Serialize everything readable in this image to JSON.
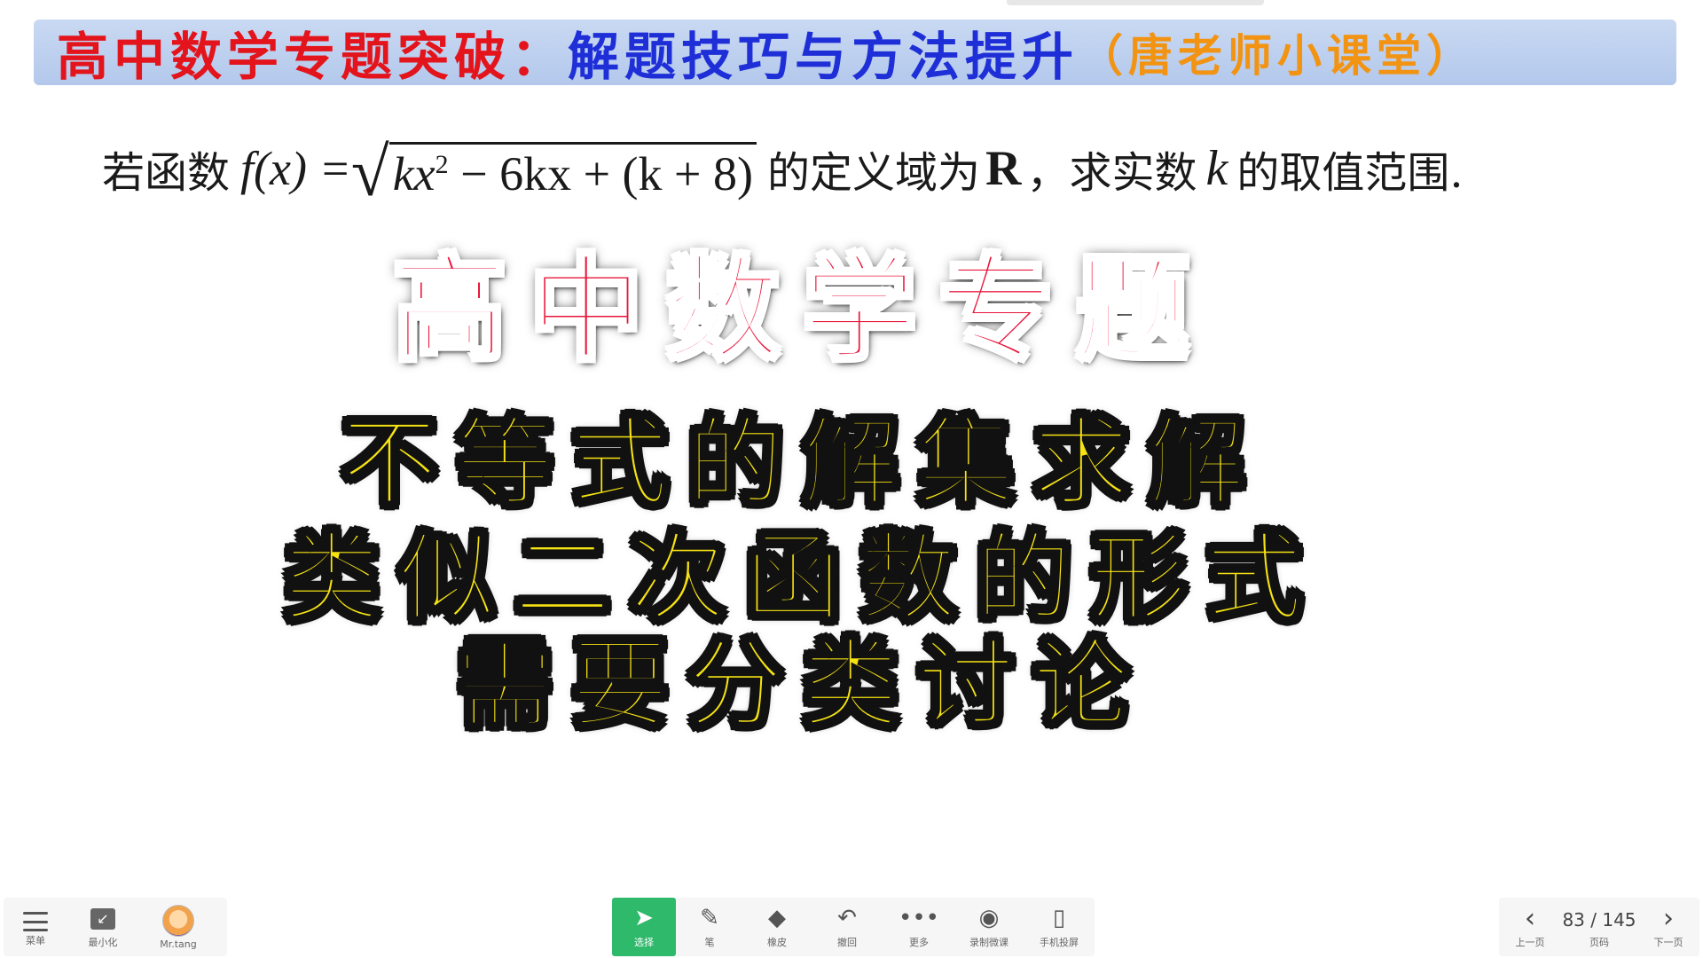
{
  "header": {
    "title_red": "高中数学专题突破：",
    "title_blue": "解题技巧与方法提升",
    "title_orange": "（唐老师小课堂）"
  },
  "problem": {
    "prefix": "若函数",
    "fx": "f(x) =",
    "radicand_a": "kx",
    "radicand_exp": "2",
    "radicand_b": " − 6kx + (k + 8)",
    "mid": "的定义域为",
    "set_r": "R",
    "mid2": "，求实数",
    "var_k": "k",
    "suffix": "的取值范围."
  },
  "overlay": {
    "title": "高中数学专题",
    "line1": "不等式的解集求解",
    "line2": "类似二次函数的形式",
    "line3": "需要分类讨论"
  },
  "toolbar": {
    "left": [
      {
        "name": "menu",
        "label": "菜单",
        "icon": "menu-icon"
      },
      {
        "name": "minimize",
        "label": "最小化",
        "icon": "minimize-icon"
      },
      {
        "name": "user",
        "label": "Mr.tang",
        "icon": "avatar-icon"
      }
    ],
    "center": [
      {
        "name": "select",
        "label": "选择",
        "icon": "cursor-arrow-icon",
        "active": true
      },
      {
        "name": "pen",
        "label": "笔",
        "icon": "pen-icon"
      },
      {
        "name": "eraser",
        "label": "橡皮",
        "icon": "eraser-icon"
      },
      {
        "name": "undo",
        "label": "撤回",
        "icon": "undo-icon"
      },
      {
        "name": "more",
        "label": "更多",
        "icon": "more-dots-icon"
      },
      {
        "name": "record",
        "label": "录制微课",
        "icon": "record-icon"
      },
      {
        "name": "phone",
        "label": "手机投屏",
        "icon": "phone-icon"
      }
    ],
    "right": {
      "prev_label": "上一页",
      "page_current": "83",
      "page_total": "145",
      "page_text": "83 / 145",
      "page_label": "页码",
      "next_label": "下一页"
    }
  },
  "colors": {
    "banner_red": "#e3141b",
    "banner_blue": "#1f2fd8",
    "banner_orange": "#f29312",
    "overlay_red": "#e8163a",
    "overlay_yellow": "#f6e312",
    "active_tool": "#2fb96a"
  }
}
